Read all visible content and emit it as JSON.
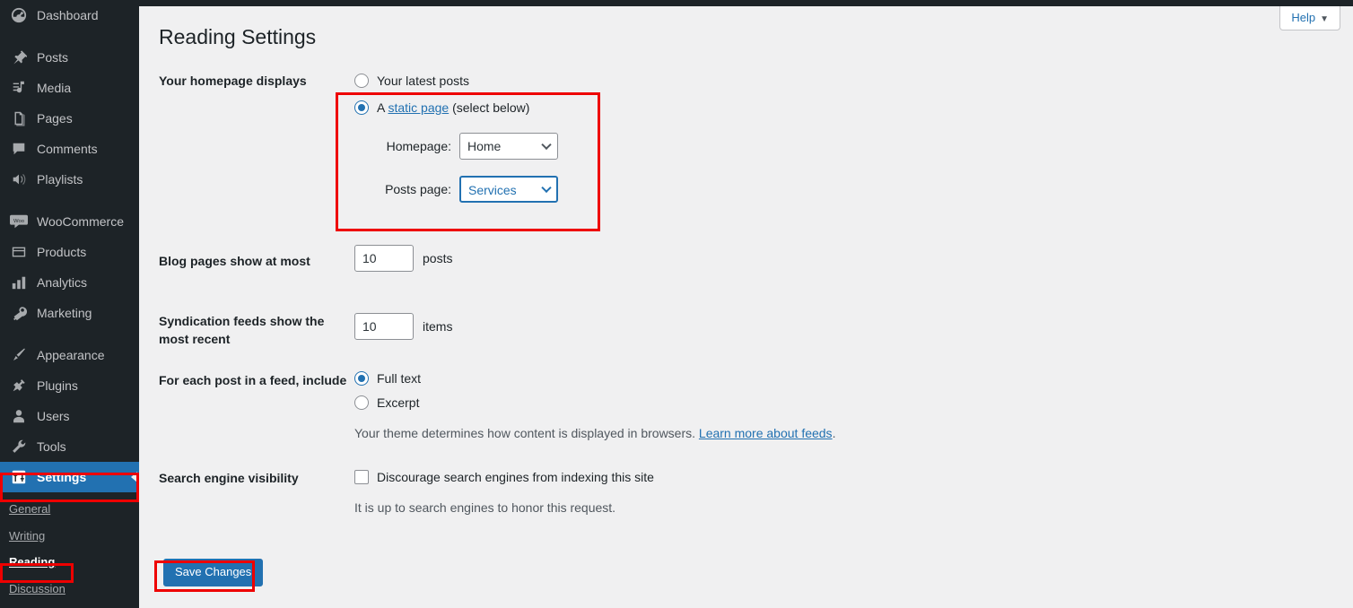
{
  "sidebar": {
    "items": [
      {
        "label": "Dashboard",
        "icon": "dashboard-icon",
        "current": false,
        "gap_after": true
      },
      {
        "label": "Posts",
        "icon": "pin-icon",
        "current": false,
        "gap_after": false
      },
      {
        "label": "Media",
        "icon": "media-icon",
        "current": false,
        "gap_after": false
      },
      {
        "label": "Pages",
        "icon": "pages-icon",
        "current": false,
        "gap_after": false
      },
      {
        "label": "Comments",
        "icon": "comments-icon",
        "current": false,
        "gap_after": false
      },
      {
        "label": "Playlists",
        "icon": "speaker-icon",
        "current": false,
        "gap_after": true
      },
      {
        "label": "WooCommerce",
        "icon": "woocommerce-icon",
        "current": false,
        "gap_after": false
      },
      {
        "label": "Products",
        "icon": "products-icon",
        "current": false,
        "gap_after": false
      },
      {
        "label": "Analytics",
        "icon": "analytics-icon",
        "current": false,
        "gap_after": false
      },
      {
        "label": "Marketing",
        "icon": "megaphone-icon",
        "current": false,
        "gap_after": true
      },
      {
        "label": "Appearance",
        "icon": "paintbrush-icon",
        "current": false,
        "gap_after": false
      },
      {
        "label": "Plugins",
        "icon": "plugin-icon",
        "current": false,
        "gap_after": false
      },
      {
        "label": "Users",
        "icon": "user-icon",
        "current": false,
        "gap_after": false
      },
      {
        "label": "Tools",
        "icon": "wrench-icon",
        "current": false,
        "gap_after": false
      },
      {
        "label": "Settings",
        "icon": "settings-sliders-icon",
        "current": true,
        "gap_after": false
      }
    ],
    "submenu": [
      {
        "label": "General",
        "current": false
      },
      {
        "label": "Writing",
        "current": false
      },
      {
        "label": "Reading",
        "current": true
      },
      {
        "label": "Discussion",
        "current": false
      }
    ]
  },
  "header": {
    "help_label": "Help",
    "help_caret": "▼",
    "page_title": "Reading Settings"
  },
  "settings": {
    "homepage_displays": {
      "label": "Your homepage displays",
      "option_latest": "Your latest posts",
      "option_static_prefix": "A ",
      "option_static_link": "static page",
      "option_static_suffix": " (select below)",
      "selected": "static",
      "homepage_label": "Homepage:",
      "homepage_value": "Home",
      "homepage_options": [
        "Home"
      ],
      "posts_page_label": "Posts page:",
      "posts_page_value": "Services",
      "posts_page_options": [
        "Services"
      ]
    },
    "blog_pages": {
      "label": "Blog pages show at most",
      "value": "10",
      "suffix": "posts"
    },
    "syndication": {
      "label": "Syndication feeds show the most recent",
      "value": "10",
      "suffix": "items"
    },
    "feed_include": {
      "label": "For each post in a feed, include",
      "option_full": "Full text",
      "option_excerpt": "Excerpt",
      "selected": "full",
      "hint_text": "Your theme determines how content is displayed in browsers. ",
      "hint_link": "Learn more about feeds",
      "hint_suffix": "."
    },
    "search_visibility": {
      "label": "Search engine visibility",
      "checkbox_label": "Discourage search engines from indexing this site",
      "checked": false,
      "hint": "It is up to search engines to honor this request."
    },
    "save_label": "Save Changes"
  },
  "colors": {
    "sidebar_bg": "#1d2327",
    "accent_blue": "#2271b1",
    "content_bg": "#f0f0f1",
    "highlight_red": "#ee0000"
  }
}
